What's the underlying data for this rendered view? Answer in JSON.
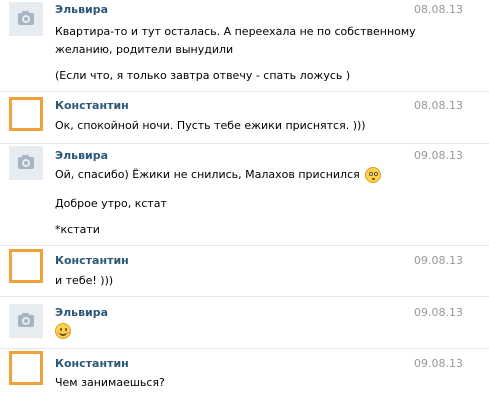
{
  "messages": [
    {
      "author": "Эльвира",
      "date": "08.08.13",
      "lines": [
        "Квартира-то и тут осталась. А переехала не по собственному",
        "желанию, родители вынудили",
        "(Если что, я только завтра отвечу - спать ложусь )"
      ]
    },
    {
      "author": "Константин",
      "date": "08.08.13",
      "lines": [
        "Ок, спокойной ночи. Пусть тебе ежики приснятся. )))"
      ]
    },
    {
      "author": "Эльвира",
      "date": "09.08.13",
      "lines": [
        "Ой, спасибо) Ёжики не снились, Малахов приснился",
        "Доброе утро, кстат",
        "*кстати"
      ],
      "emoji_after_line_0": "confused-face-emoji"
    },
    {
      "author": "Константин",
      "date": "09.08.13",
      "lines": [
        "и тебе! )))"
      ]
    },
    {
      "author": "Эльвира",
      "date": "09.08.13",
      "lines": [],
      "emoji": "smile-emoji"
    },
    {
      "author": "Константин",
      "date": "09.08.13",
      "lines": [
        "Чем занимаешься?"
      ]
    }
  ],
  "colors": {
    "author_name": "#2b587a",
    "date": "#999999",
    "orange_avatar_border": "#f0a23c",
    "camera_avatar_bg": "#e7ecf0",
    "divider": "#e4e8ed"
  }
}
